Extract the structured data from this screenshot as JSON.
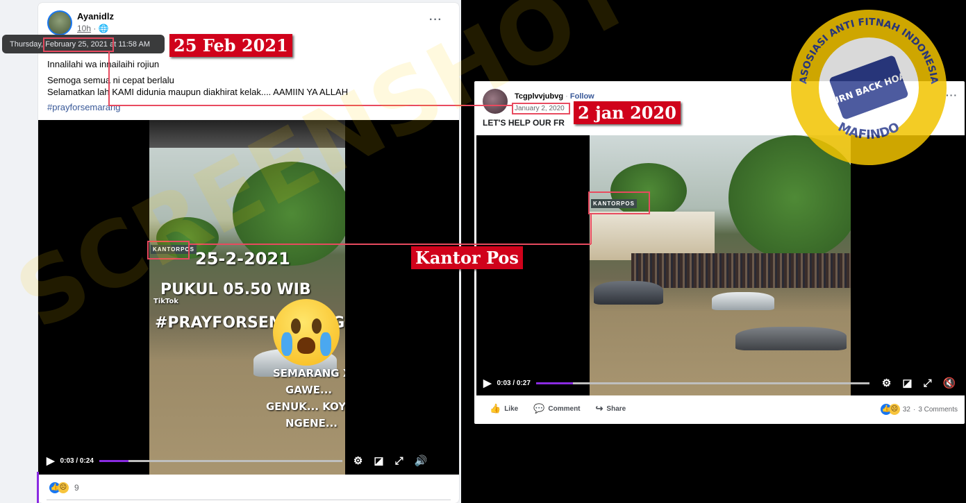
{
  "left_post": {
    "author": "Ayanidlz",
    "time": "10h",
    "tooltip": "Thursday, February 25, 2021 at 11:58 AM",
    "text_line1": "Innalilahi wa innailaihi rojiun",
    "text_line2": "Semoga semua ni cepat berlalu",
    "text_line3": "Selamatkan lah KAMI didunia maupun diakhirat kelak.... AAMIIN YA ALLAH",
    "hashtag": "#prayforsemarang",
    "video_overlay_date": "25-2-2021",
    "video_overlay_time": "PUKUL 05.50 WIB",
    "video_overlay_tag": "#PRAYFORSEMARANG",
    "video_overlay_source": "TikTok",
    "video_overlay_caption1": "SEMARANG X",
    "video_overlay_caption2": "GAWE...",
    "video_overlay_caption3": "GENUK... KOYO",
    "video_overlay_caption4": "NGENE...",
    "sign_text": "KANTORPOS",
    "video_time": "0:03 / 0:24",
    "progress": 0.12,
    "reaction_count": "9"
  },
  "right_post": {
    "author": "Tcgplvvjubvg",
    "follow": "Follow",
    "date": "January 2, 2020",
    "text": "LET'S HELP OUR FR",
    "sign_text": "KANTORPOS",
    "video_time": "0:03 / 0:27",
    "progress": 0.11,
    "actions": {
      "like": "Like",
      "comment": "Comment",
      "share": "Share"
    },
    "reaction_count": "32",
    "comments": "3 Comments"
  },
  "annotations": {
    "label_left_date": "25 Feb 2021",
    "label_right_date": "2 jan 2020",
    "label_kantor_pos": "Kantor Pos"
  },
  "watermark": {
    "logo_top": "ASOSIASI ANTI FITNAH INDONESIA",
    "logo_center": "TURN BACK HOAX",
    "logo_bottom": "MAFINDO",
    "diagonal": "SCREENSHOT"
  },
  "colors": {
    "facebook_blue": "#1877f2",
    "annotation_red": "#d0021b",
    "highlight_pink": "#e84a5f",
    "progress_purple": "#8a2be2",
    "watermark_yellow": "#f2c400"
  }
}
